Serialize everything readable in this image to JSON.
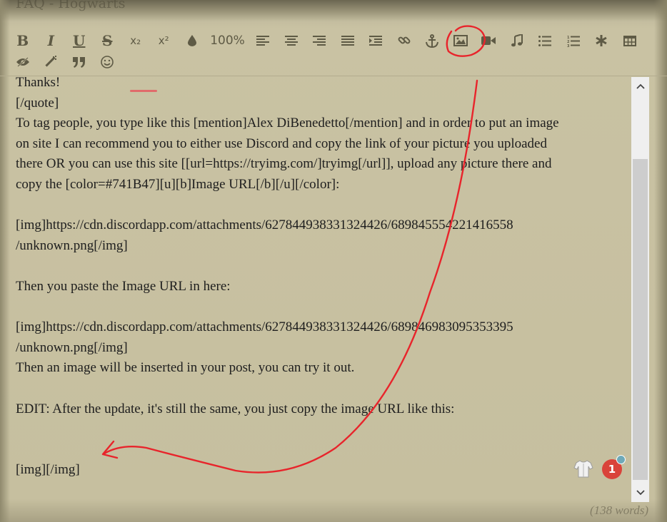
{
  "window": {
    "title": "FAQ - Hogwarts"
  },
  "toolbar": {
    "buttons": [
      {
        "label": "B",
        "icon": "bold-icon"
      },
      {
        "label": "I",
        "icon": "italic-icon"
      },
      {
        "label": "U",
        "icon": "underline-icon"
      },
      {
        "label": "S",
        "icon": "strikethrough-icon"
      },
      {
        "label": "x₂",
        "icon": "subscript-icon"
      },
      {
        "label": "x²",
        "icon": "superscript-icon"
      },
      {
        "label": "",
        "icon": "color-drop-icon"
      },
      {
        "label": "100%",
        "icon": "font-size-button"
      },
      {
        "label": "",
        "icon": "align-left-icon"
      },
      {
        "label": "",
        "icon": "align-center-icon"
      },
      {
        "label": "",
        "icon": "align-right-icon"
      },
      {
        "label": "",
        "icon": "align-justify-icon"
      },
      {
        "label": "",
        "icon": "indent-icon"
      },
      {
        "label": "",
        "icon": "link-icon"
      },
      {
        "label": "",
        "icon": "anchor-icon"
      },
      {
        "label": "",
        "icon": "image-icon"
      },
      {
        "label": "",
        "icon": "video-icon"
      },
      {
        "label": "",
        "icon": "music-icon"
      },
      {
        "label": "",
        "icon": "bullet-list-icon"
      },
      {
        "label": "",
        "icon": "numbered-list-icon"
      },
      {
        "label": "",
        "icon": "asterisk-icon"
      },
      {
        "label": "",
        "icon": "table-icon"
      },
      {
        "label": "",
        "icon": "hide-icon"
      },
      {
        "label": "",
        "icon": "magic-wand-icon"
      },
      {
        "label": "",
        "icon": "quote-icon"
      },
      {
        "label": "",
        "icon": "smiley-icon"
      }
    ]
  },
  "editor": {
    "lines": [
      "Thanks!",
      "[/quote]",
      "To tag people, you type like this [mention]Alex DiBenedetto[/mention] and in order to put an image",
      "on site I can recommend you to either use Discord and copy the link of your picture you uploaded",
      "there OR you can use this site [[url=https://tryimg.com/]tryimg[/url]], upload any picture there and",
      "copy the [color=#741B47][u][b]Image URL[/b][/u][/color]:",
      "",
      "[img]https://cdn.discordapp.com/attachments/627844938331324426/689845554221416558",
      "/unknown.png[/img]",
      "",
      "Then you paste the Image URL in here:",
      "",
      "[img]https://cdn.discordapp.com/attachments/627844938331324426/689846983095353395",
      "/unknown.png[/img]",
      "Then an image will be inserted in your post, you can try it out.",
      "",
      "EDIT: After the update, it's still the same, you just copy the image URL like this:",
      "",
      "",
      "[img][/img]"
    ]
  },
  "word_count": "(138 words)",
  "notifications": {
    "count": "1"
  },
  "colors": {
    "annotation": "#e8242b",
    "toolbar_icon": "#5e5a45",
    "badge": "#d9433a"
  }
}
